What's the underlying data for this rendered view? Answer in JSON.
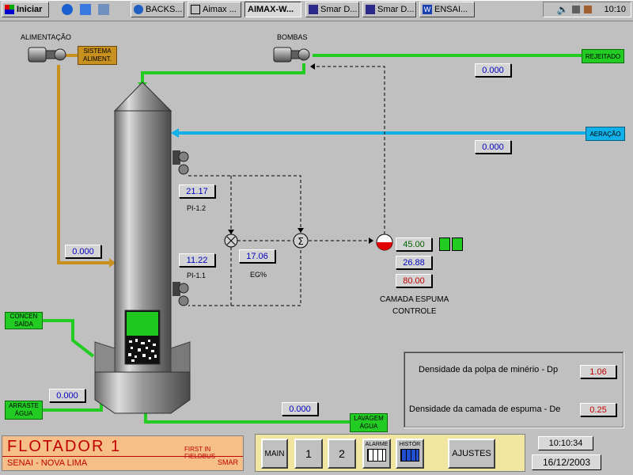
{
  "taskbar": {
    "start_label": "Iniciar",
    "tasks": [
      {
        "label": "BACKS..."
      },
      {
        "label": "Aimax ..."
      },
      {
        "label": "AIMAX-W..."
      },
      {
        "label": "Smar D..."
      },
      {
        "label": "Smar D..."
      },
      {
        "label": "ENSAI..."
      }
    ],
    "clock": "10:10"
  },
  "process": {
    "alimentacao_label": "ALIMENTAÇÃO",
    "sistema_label": "SISTEMA\nALIMENT.",
    "bombas_label": "BOMBAS",
    "rejeitado_label": "REJEITADO",
    "aeracao_label": "AERAÇÃO",
    "concentrado_label": "CONCEN\nSAÍDA",
    "arraste_label": "ARRASTE\nÁGUA",
    "lavagem_label": "LAVAGEM\nÁGUA",
    "pi12_label": "PI-1.2",
    "pi11_label": "PI-1.1",
    "eg_label": "EG%",
    "camada_label": "CAMADA ESPUMA",
    "controle_label": "CONTROLE",
    "values": {
      "rejeitado": "0.000",
      "aeracao": "0.000",
      "alimentacao": "0.000",
      "arraste": "0.000",
      "lavagem": "0.000",
      "pi12": "21.17",
      "pi11": "11.22",
      "eg": "17.06",
      "sp": "45.00",
      "pv": "26.88",
      "out": "80.00"
    }
  },
  "density": {
    "dp_label": "Densidade da polpa de minério - Dp",
    "dp_value": "1.06",
    "de_label": "Densidade da camada de espuma - De",
    "de_value": "0.25"
  },
  "footer": {
    "title": "FLOTADOR 1",
    "subtitle": "SENAI - NOVA LIMA",
    "right_top": "FIRST IN FIELDBUS",
    "right_bottom": "SMAR",
    "nav": {
      "main": "MAIN",
      "one": "1",
      "two": "2",
      "alarme": "ALARME",
      "histor": "HISTÓR",
      "ajustes": "AJUSTES"
    },
    "time": "10:10:34",
    "date": "16/12/2003"
  },
  "colors": {
    "feed_line": "#c8901e",
    "green_line": "#22cc22",
    "air_line": "#10b0e8",
    "footer_bg": "#f5bf87",
    "footer_text": "#c00000"
  }
}
